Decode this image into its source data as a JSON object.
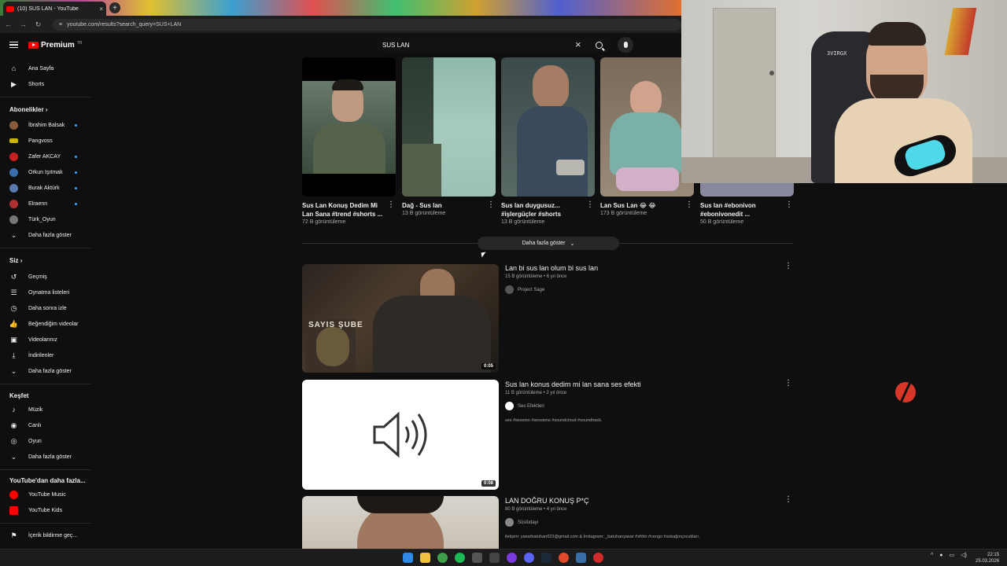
{
  "browser": {
    "tab_title": "(10) SUS LAN - YouTube",
    "tab_close": "×",
    "new_tab": "+",
    "url": "youtube.com/results?search_query=SUS+LAN"
  },
  "header": {
    "logo_text": "Premium",
    "logo_superscript": "TR",
    "search_value": "SUS LAN",
    "clear_glyph": "×"
  },
  "sidebar": {
    "main": [
      {
        "label": "Ana Sayfa",
        "icon": "home-icon"
      },
      {
        "label": "Shorts",
        "icon": "shorts-icon"
      }
    ],
    "subscriptions_title": "Abonelikler",
    "subscriptions": [
      {
        "label": "İbrahim Balsak",
        "color": "#8a5a3c",
        "dot": true
      },
      {
        "label": "Pangvoss",
        "color": "#c8b400",
        "dot": false
      },
      {
        "label": "Zafer AKCAY",
        "color": "#c62020",
        "dot": true
      },
      {
        "label": "Orkun Işıtmak",
        "color": "#3a6ea8",
        "dot": true
      },
      {
        "label": "Burak Aktürk",
        "color": "#5a7ab0",
        "dot": true
      },
      {
        "label": "Elraenn",
        "color": "#b03030",
        "dot": true
      },
      {
        "label": "Türk_Oyun",
        "color": "#777777",
        "dot": false
      }
    ],
    "subs_more": "Daha fazla göster",
    "you_title": "Siz",
    "you_items": [
      {
        "label": "Geçmiş",
        "icon": "history-icon"
      },
      {
        "label": "Oynatma listeleri",
        "icon": "playlist-icon"
      },
      {
        "label": "Daha sonra izle",
        "icon": "clock-icon"
      },
      {
        "label": "Beğendiğim videolar",
        "icon": "like-icon"
      },
      {
        "label": "Videolarınız",
        "icon": "your-videos-icon"
      },
      {
        "label": "İndirilenler",
        "icon": "download-icon"
      },
      {
        "label": "Daha fazla göster",
        "icon": "chevron-down-icon"
      }
    ],
    "explore_title": "Keşfet",
    "explore_items": [
      {
        "label": "Müzik",
        "icon": "music-icon"
      },
      {
        "label": "Canlı",
        "icon": "live-icon"
      },
      {
        "label": "Oyun",
        "icon": "gaming-icon"
      },
      {
        "label": "Daha fazla göster",
        "icon": "chevron-down-icon"
      }
    ],
    "more_from_title": "YouTube'dan daha fazla...",
    "more_from": [
      {
        "label": "YouTube Music",
        "color": "#ff0000"
      },
      {
        "label": "YouTube Kids",
        "color": "#ff0000"
      }
    ],
    "report": "İçerik bildirme geç..."
  },
  "shorts": [
    {
      "title_l1": "Sus Lan Konuş Dedim Mi",
      "title_l2": "Lan Sana  #trend #shorts ...",
      "views": "72 B görüntüleme"
    },
    {
      "title_l1": "Dağ - Sus lan",
      "title_l2": "",
      "views": "13 B görüntüleme"
    },
    {
      "title_l1": "Sus lan duygusuz...",
      "title_l2": "#işlergüçler #shorts",
      "views": "13 B görüntüleme"
    },
    {
      "title_l1": "Lan Sus Lan 😂 😂",
      "title_l2": "",
      "views": "173 B görüntüleme"
    },
    {
      "title_l1": "Sus lan #ebonivon",
      "title_l2": "#ebonivonedit ...",
      "views": "50 B görüntüleme"
    }
  ],
  "show_more": "Daha fazla göster",
  "videos": [
    {
      "title": "Lan bi sus lan olum bi sus lan",
      "meta": "15 B görüntüleme • 6 yıl önce",
      "channel": "Project Sage",
      "desc": "",
      "duration": "0:05"
    },
    {
      "title": "Sus lan konus dedim mi lan sana ses efekti",
      "meta": "11 B görüntüleme • 2 yıl önce",
      "channel": "Ses Efektleri",
      "desc": "ses #session #sessions #soundcloud #soundtrack.",
      "duration": "0:08"
    },
    {
      "title": "LAN DOĞRU KONUŞ P*Ç",
      "meta": "80 B görüntüleme • 4 yıl önce",
      "channel": "Süslüdayı",
      "desc": "iletişim: yasarbatuhan023@gmail.com & İnstagram: _batuhanyasar #sfrbir #cengo #sokağınçocukları.",
      "duration": ""
    }
  ],
  "taskbar": {
    "time": "22:15",
    "date": "25.03.2026"
  }
}
